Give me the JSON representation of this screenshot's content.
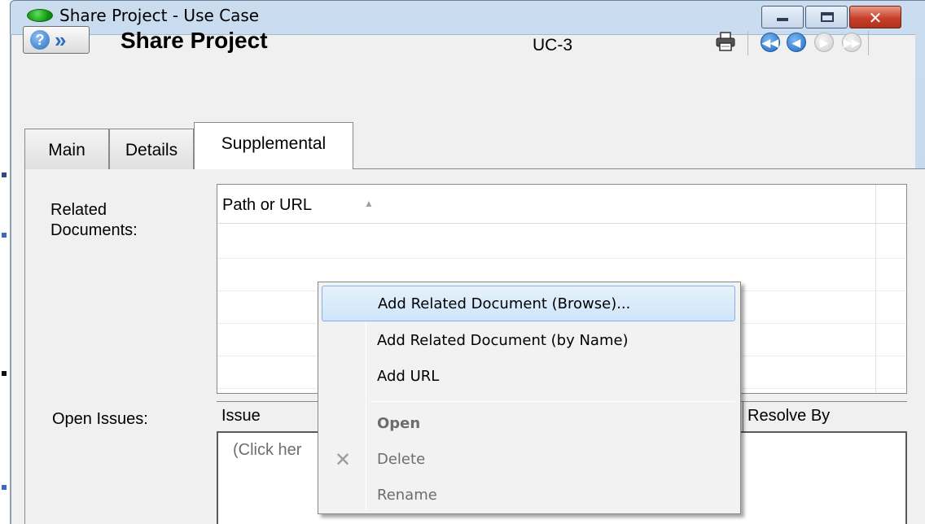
{
  "window": {
    "title": "Share Project - Use Case",
    "controls": {
      "minimize": "minimize",
      "maximize": "maximize",
      "close": "close"
    }
  },
  "header": {
    "help_button_icons": [
      "help-icon",
      "chevron-double-right-icon"
    ],
    "title": "Share Project",
    "id": "UC-3",
    "toolbar_icons": [
      "print-icon",
      "first-record-icon",
      "previous-record-icon",
      "next-record-icon",
      "last-record-icon"
    ]
  },
  "tabs": [
    {
      "label": "Main",
      "active": false
    },
    {
      "label": "Details",
      "active": false
    },
    {
      "label": "Supplemental",
      "active": true
    }
  ],
  "related_documents": {
    "label": "Related\nDocuments:",
    "columns": [
      "Path or URL"
    ],
    "rows": []
  },
  "open_issues": {
    "label": "Open Issues:",
    "columns": [
      "Issue",
      "Resolve By"
    ],
    "placeholder": "(Click her"
  },
  "context_menu": {
    "items": [
      {
        "label": "Add Related Document (Browse)...",
        "state": "highlighted"
      },
      {
        "label": "Add Related Document (by Name)",
        "state": "enabled"
      },
      {
        "label": "Add URL",
        "state": "enabled"
      },
      {
        "label": "Open",
        "state": "disabled-bold"
      },
      {
        "label": "Delete",
        "state": "disabled",
        "icon": "delete-icon"
      },
      {
        "label": "Rename",
        "state": "disabled"
      }
    ]
  },
  "colors": {
    "title_bar": "#c4d7ed",
    "menu_highlight": "#cfe5fb",
    "close_button": "#c7402a",
    "nav_active": "#2068c0"
  }
}
